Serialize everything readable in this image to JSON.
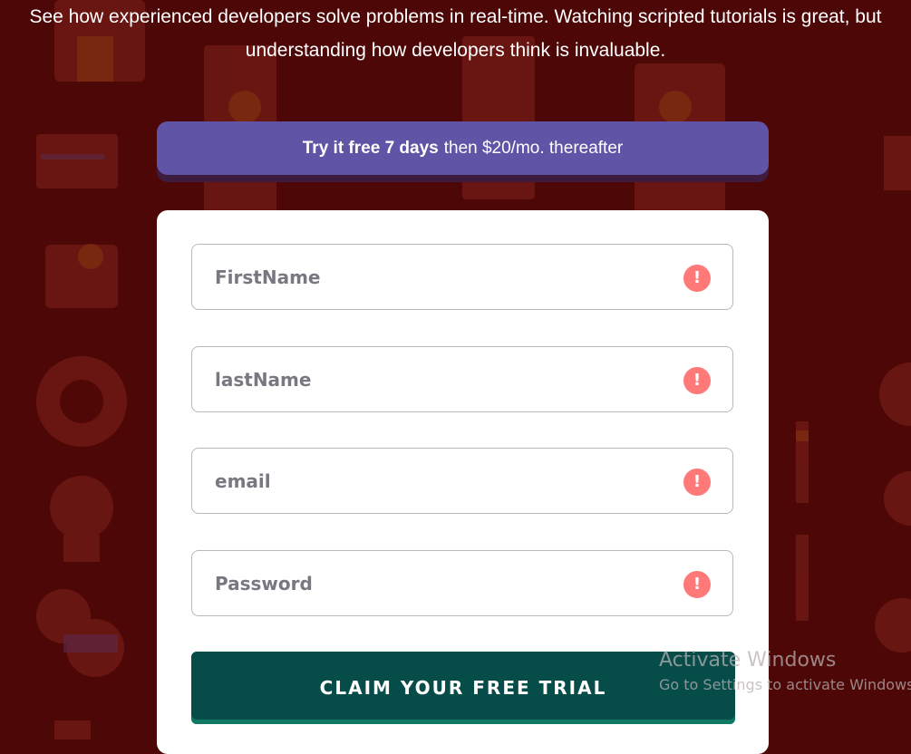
{
  "intro": {
    "line1": "See how experienced developers solve problems in real-time. Watching scripted tutorials is great, but",
    "line2": "understanding how developers think is invaluable."
  },
  "banner": {
    "bold": "Try it free 7 days",
    "rest": "then $20/mo. thereafter"
  },
  "form": {
    "fields": [
      {
        "placeholder": "FirstName",
        "value": ""
      },
      {
        "placeholder": "lastName",
        "value": ""
      },
      {
        "placeholder": "email",
        "value": ""
      },
      {
        "placeholder": "Password",
        "value": ""
      }
    ],
    "error_icon": "exclamation-icon",
    "error_glyph": "!",
    "submit_label": "CLAIM YOUR FREE TRIAL"
  },
  "watermark": {
    "title": "Activate Windows",
    "subtitle": "Go to Settings to activate Windows."
  },
  "colors": {
    "background": "#4e0707",
    "banner": "#5f54a5",
    "error": "#ff7979",
    "button": "#064d4a"
  }
}
